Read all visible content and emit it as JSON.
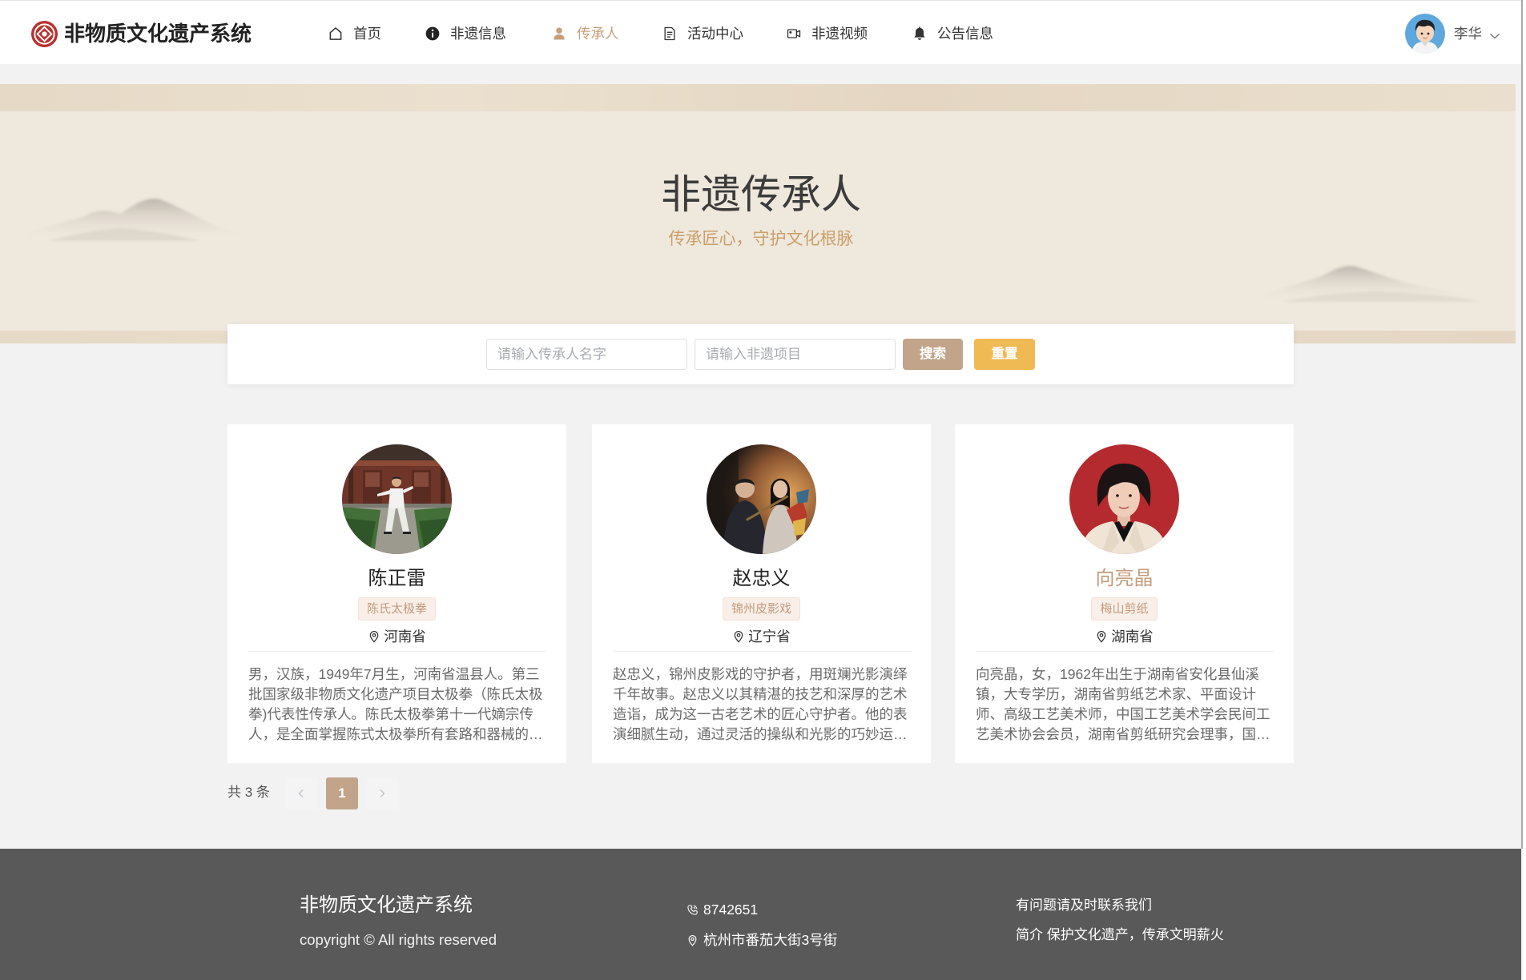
{
  "app": {
    "title": "非物质文化遗产系统"
  },
  "nav": {
    "items": [
      {
        "label": "首页",
        "icon": "home-icon"
      },
      {
        "label": "非遗信息",
        "icon": "info-icon"
      },
      {
        "label": "传承人",
        "icon": "user-icon",
        "active": true
      },
      {
        "label": "活动中心",
        "icon": "document-icon"
      },
      {
        "label": "非遗视频",
        "icon": "video-icon"
      },
      {
        "label": "公告信息",
        "icon": "bell-icon"
      }
    ]
  },
  "user": {
    "name": "李华",
    "menu_icon": "chevron-down-icon"
  },
  "banner": {
    "title": "非遗传承人",
    "subtitle": "传承匠心，守护文化根脉"
  },
  "search": {
    "name_placeholder": "请输入传承人名字",
    "project_placeholder": "请输入非遗项目",
    "search_label": "搜索",
    "reset_label": "重置"
  },
  "inheritors": [
    {
      "name": "陈正雷",
      "project": "陈氏太极拳",
      "location": "河南省",
      "description": "男，汉族，1949年7月生，河南省温县人。第三批国家级非物质文化遗产项目太极拳（陈氏太极拳)代表性传承人。陈氏太极拳第十一代嫡宗传人，是全面掌握陈式太极拳所有套路和器械的…"
    },
    {
      "name": "赵忠义",
      "project": "锦州皮影戏",
      "location": "辽宁省",
      "description": "赵忠义，锦州皮影戏的守护者，用斑斓光影演绎千年故事。赵忠义以其精湛的技艺和深厚的艺术造诣，成为这一古老艺术的匠心守护者。他的表演细腻生动，通过灵活的操纵和光影的巧妙运…"
    },
    {
      "name": "向亮晶",
      "project": "梅山剪纸",
      "location": "湖南省",
      "description": "向亮晶，女，1962年出生于湖南省安化县仙溪镇，大专学历，湖南省剪纸艺术家、平面设计师、高级工艺美术师，中国工艺美术学会民间工艺美术协会会员，湖南省剪纸研究会理事，国…"
    }
  ],
  "pagination": {
    "total_label": "共 3 条",
    "current_page": "1",
    "prev_icon": "chevron-left-icon",
    "next_icon": "chevron-right-icon"
  },
  "footer": {
    "title": "非物质文化遗产系统",
    "copyright": "copyright © All rights reserved",
    "phone": "8742651",
    "address": "杭州市番茄大街3号街",
    "contact_prompt": "有问题请及时联系我们",
    "intro": "简介 保护文化遗产，传承文明薪火"
  },
  "colors": {
    "accent": "#c69f79",
    "accent_muted": "#c2a48a",
    "reset_button": "#efb954",
    "banner_bg": "#efe8dd",
    "footer_bg": "#595959",
    "logo_red": "#b83230"
  }
}
